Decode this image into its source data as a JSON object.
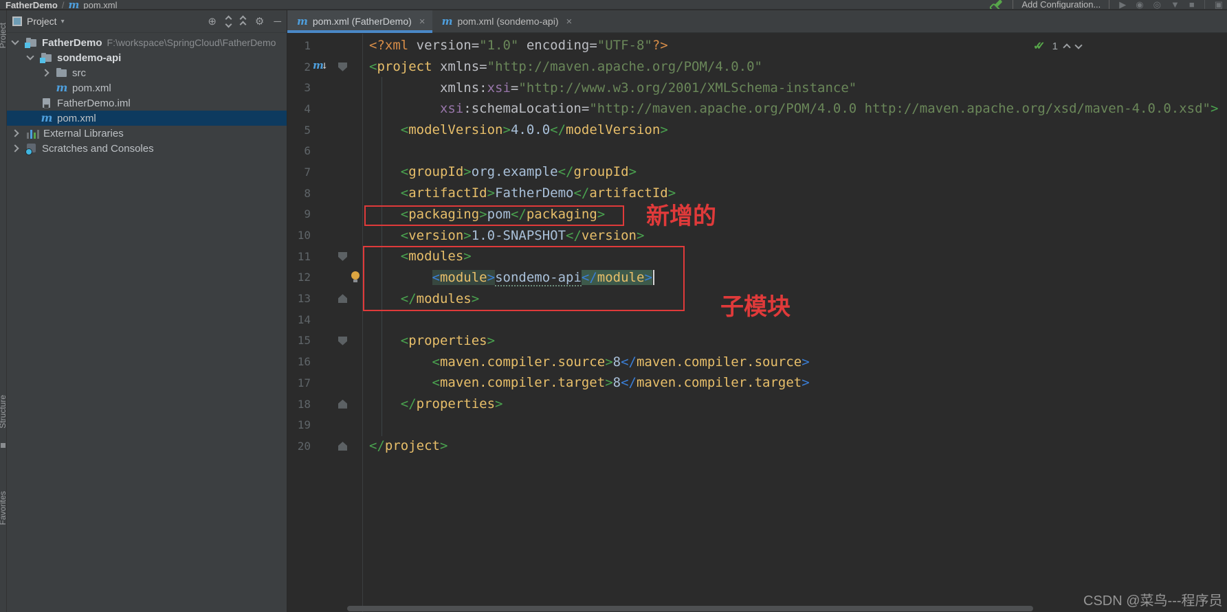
{
  "topbar": {
    "breadcrumb": {
      "project": "FatherDemo",
      "separator": "/",
      "file": "pom.xml"
    },
    "add_configuration_label": "Add Configuration...",
    "icons": {
      "play": "▶",
      "dropdown": "▼",
      "stop": "■",
      "bug": "◉",
      "coverage": "◎",
      "layout": "▣"
    }
  },
  "project_panel": {
    "header": {
      "title": "Project",
      "caret": "▾"
    },
    "tree": [
      {
        "indent": 0,
        "chevron": "open",
        "icon": "folder-module",
        "label": "FatherDemo",
        "bold": true,
        "path": "F:\\workspace\\SpringCloud\\FatherDemo"
      },
      {
        "indent": 1,
        "chevron": "open",
        "icon": "folder-module",
        "label": "sondemo-api",
        "bold": true
      },
      {
        "indent": 2,
        "chevron": "closed",
        "icon": "folder",
        "label": "src"
      },
      {
        "indent": 2,
        "chevron": "none",
        "icon": "maven",
        "label": "pom.xml"
      },
      {
        "indent": 1,
        "chevron": "none",
        "icon": "iml",
        "label": "FatherDemo.iml"
      },
      {
        "indent": 1,
        "chevron": "none",
        "icon": "maven",
        "label": "pom.xml",
        "selected": true
      },
      {
        "indent": 0,
        "chevron": "closed",
        "icon": "libs",
        "label": "External Libraries"
      },
      {
        "indent": 0,
        "chevron": "closed",
        "icon": "scratch",
        "label": "Scratches and Consoles"
      }
    ]
  },
  "tabs": [
    {
      "label": "pom.xml (FatherDemo)",
      "close": "×",
      "active": true
    },
    {
      "label": "pom.xml (sondemo-api)",
      "close": "×",
      "active": false
    }
  ],
  "editor": {
    "inspection": {
      "checks": "✓✓",
      "count": "1"
    },
    "lines": [
      {
        "n": 1,
        "t": [
          [
            "pi",
            "<?xml "
          ],
          [
            "attr",
            "version="
          ],
          [
            "str",
            "\"1.0\""
          ],
          [
            "pl",
            " "
          ],
          [
            "attr",
            "encoding="
          ],
          [
            "str",
            "\"UTF-8\""
          ],
          [
            "pi",
            "?>"
          ]
        ]
      },
      {
        "n": 2,
        "maven": true,
        "fold": "down",
        "t": [
          [
            "br",
            "<"
          ],
          [
            "tag",
            "project"
          ],
          [
            "pl",
            " "
          ],
          [
            "attr",
            "xmlns="
          ],
          [
            "str",
            "\"http://maven.apache.org/POM/4.0.0\""
          ]
        ]
      },
      {
        "n": 3,
        "t": [
          [
            "pl",
            "         "
          ],
          [
            "attr",
            "xmlns:"
          ],
          [
            "ns",
            "xsi"
          ],
          [
            "attr",
            "="
          ],
          [
            "str",
            "\"http://www.w3.org/2001/XMLSchema-instance\""
          ]
        ]
      },
      {
        "n": 4,
        "t": [
          [
            "pl",
            "         "
          ],
          [
            "ns",
            "xsi"
          ],
          [
            "attr",
            ":schemaLocation="
          ],
          [
            "str",
            "\"http://maven.apache.org/POM/4.0.0 http://maven.apache.org/xsd/maven-4.0.0.xsd\""
          ],
          [
            "br",
            ">"
          ]
        ]
      },
      {
        "n": 5,
        "t": [
          [
            "pl",
            "    "
          ],
          [
            "br",
            "<"
          ],
          [
            "tag",
            "modelVersion"
          ],
          [
            "br",
            ">"
          ],
          [
            "txt",
            "4.0.0"
          ],
          [
            "br",
            "</"
          ],
          [
            "tag",
            "modelVersion"
          ],
          [
            "br",
            ">"
          ]
        ]
      },
      {
        "n": 6,
        "t": []
      },
      {
        "n": 7,
        "t": [
          [
            "pl",
            "    "
          ],
          [
            "br",
            "<"
          ],
          [
            "tag",
            "groupId"
          ],
          [
            "br",
            ">"
          ],
          [
            "txt",
            "org.example"
          ],
          [
            "br",
            "</"
          ],
          [
            "tag",
            "groupId"
          ],
          [
            "br",
            ">"
          ]
        ]
      },
      {
        "n": 8,
        "t": [
          [
            "pl",
            "    "
          ],
          [
            "br",
            "<"
          ],
          [
            "tag",
            "artifactId"
          ],
          [
            "br",
            ">"
          ],
          [
            "txt",
            "FatherDemo"
          ],
          [
            "br",
            "</"
          ],
          [
            "tag",
            "artifactId"
          ],
          [
            "br",
            ">"
          ]
        ]
      },
      {
        "n": 9,
        "t": [
          [
            "pl",
            "    "
          ],
          [
            "br",
            "<"
          ],
          [
            "tag",
            "packaging"
          ],
          [
            "br",
            ">"
          ],
          [
            "txt",
            "pom"
          ],
          [
            "br",
            "</"
          ],
          [
            "tag",
            "packaging"
          ],
          [
            "br",
            ">"
          ]
        ]
      },
      {
        "n": 10,
        "t": [
          [
            "pl",
            "    "
          ],
          [
            "br",
            "<"
          ],
          [
            "tag",
            "version"
          ],
          [
            "br",
            ">"
          ],
          [
            "txt",
            "1.0-SNAPSHOT"
          ],
          [
            "br",
            "</"
          ],
          [
            "tag",
            "version"
          ],
          [
            "br",
            ">"
          ]
        ]
      },
      {
        "n": 11,
        "fold": "down",
        "t": [
          [
            "pl",
            "    "
          ],
          [
            "br",
            "<"
          ],
          [
            "tag",
            "modules"
          ],
          [
            "br",
            ">"
          ]
        ]
      },
      {
        "n": 12,
        "bulb": true,
        "t": [
          [
            "pl",
            "        "
          ],
          [
            "bb h1",
            "<"
          ],
          [
            "tag h1",
            "module"
          ],
          [
            "bb h1",
            ">"
          ],
          [
            "u",
            "sondemo-api"
          ],
          [
            "bb h2",
            "</"
          ],
          [
            "tag h2",
            "module"
          ],
          [
            "bb h2",
            ">"
          ],
          [
            "caret",
            ""
          ]
        ]
      },
      {
        "n": 13,
        "fold": "up",
        "t": [
          [
            "pl",
            "    "
          ],
          [
            "br",
            "</"
          ],
          [
            "tag",
            "modules"
          ],
          [
            "br",
            ">"
          ]
        ]
      },
      {
        "n": 14,
        "t": []
      },
      {
        "n": 15,
        "fold": "down",
        "t": [
          [
            "pl",
            "    "
          ],
          [
            "br",
            "<"
          ],
          [
            "tag",
            "properties"
          ],
          [
            "br",
            ">"
          ]
        ]
      },
      {
        "n": 16,
        "t": [
          [
            "pl",
            "        "
          ],
          [
            "br",
            "<"
          ],
          [
            "tag",
            "maven.compiler.source"
          ],
          [
            "br",
            ">"
          ],
          [
            "txt",
            "8"
          ],
          [
            "bb",
            "</"
          ],
          [
            "tag",
            "maven.compiler.source"
          ],
          [
            "bb",
            ">"
          ]
        ]
      },
      {
        "n": 17,
        "t": [
          [
            "pl",
            "        "
          ],
          [
            "br",
            "<"
          ],
          [
            "tag",
            "maven.compiler.target"
          ],
          [
            "br",
            ">"
          ],
          [
            "txt",
            "8"
          ],
          [
            "bb",
            "</"
          ],
          [
            "tag",
            "maven.compiler.target"
          ],
          [
            "bb",
            ">"
          ]
        ]
      },
      {
        "n": 18,
        "fold": "up",
        "t": [
          [
            "pl",
            "    "
          ],
          [
            "br",
            "</"
          ],
          [
            "tag",
            "properties"
          ],
          [
            "br",
            ">"
          ]
        ]
      },
      {
        "n": 19,
        "t": []
      },
      {
        "n": 20,
        "fold": "up",
        "t": [
          [
            "br",
            "</"
          ],
          [
            "tag",
            "project"
          ],
          [
            "br",
            ">"
          ]
        ]
      }
    ]
  },
  "annotations": {
    "added_label": "新增的",
    "submodule_label": "子模块",
    "accent_color": "#e03a3a"
  },
  "stripe": {
    "top_label": "Project",
    "mid_label": "Structure",
    "bottom_label": "Favorites"
  },
  "watermark": "CSDN @菜鸟---程序员"
}
